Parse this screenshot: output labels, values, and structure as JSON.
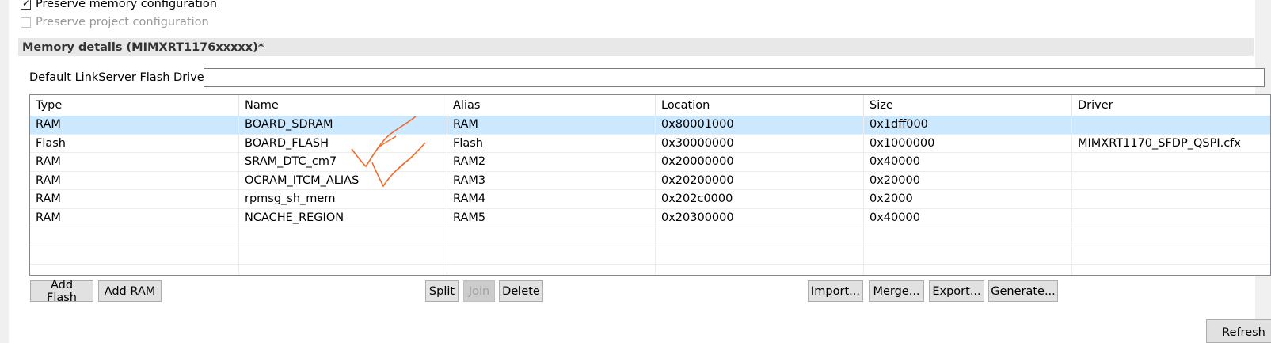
{
  "options": {
    "preserve_memory": {
      "label": "Preserve memory configuration",
      "checked": true
    },
    "preserve_project": {
      "label": "Preserve project configuration",
      "checked": false,
      "disabled": true
    }
  },
  "section": {
    "title": "Memory details (MIMXRT1176xxxxx)*"
  },
  "driver": {
    "label": "Default LinkServer Flash Driver",
    "value": ""
  },
  "table": {
    "headers": [
      "Type",
      "Name",
      "Alias",
      "Location",
      "Size",
      "Driver"
    ],
    "rows": [
      [
        "RAM",
        "BOARD_SDRAM",
        "RAM",
        "0x80001000",
        "0x1dff000",
        ""
      ],
      [
        "Flash",
        "BOARD_FLASH",
        "Flash",
        "0x30000000",
        "0x1000000",
        "MIMXRT1170_SFDP_QSPI.cfx"
      ],
      [
        "RAM",
        "SRAM_DTC_cm7",
        "RAM2",
        "0x20000000",
        "0x40000",
        ""
      ],
      [
        "RAM",
        "OCRAM_ITCM_ALIAS",
        "RAM3",
        "0x20200000",
        "0x20000",
        ""
      ],
      [
        "RAM",
        "rpmsg_sh_mem",
        "RAM4",
        "0x202c0000",
        "0x2000",
        ""
      ],
      [
        "RAM",
        "NCACHE_REGION",
        "RAM5",
        "0x20300000",
        "0x40000",
        ""
      ]
    ],
    "selected_row": 0
  },
  "buttons": {
    "add_flash": "Add Flash",
    "add_ram": "Add RAM",
    "split": "Split",
    "join": "Join",
    "delete": "Delete",
    "import": "Import...",
    "merge": "Merge...",
    "export": "Export...",
    "generate": "Generate...",
    "refresh": "Refresh"
  },
  "colors": {
    "selection": "#cce8ff",
    "annotation": "#f06a2a"
  }
}
